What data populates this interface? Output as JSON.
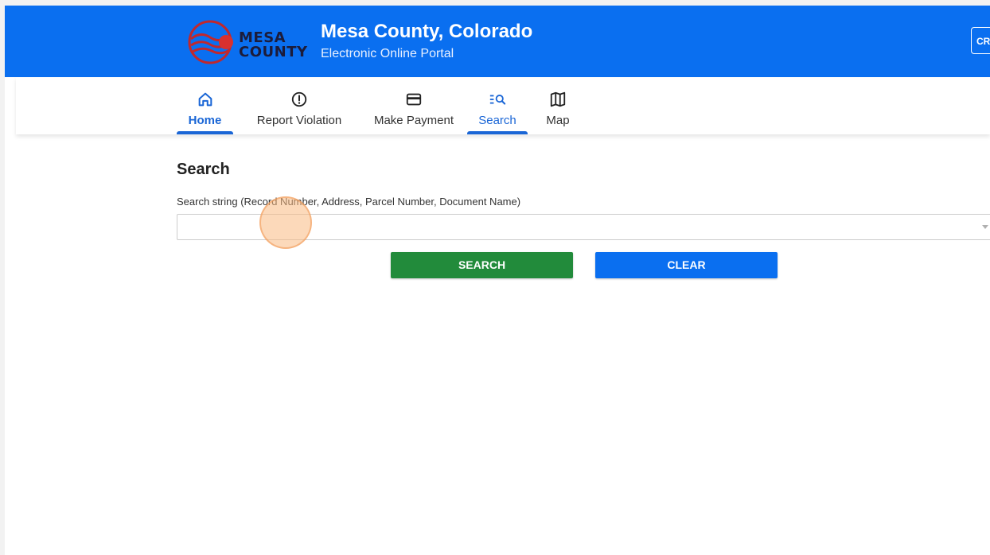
{
  "header": {
    "logo": {
      "line1": "MESA",
      "line2": "COUNTY"
    },
    "title": "Mesa County, Colorado",
    "subtitle": "Electronic Online Portal",
    "right_button_label": "CR",
    "background_color": "#0a6ff0"
  },
  "nav": {
    "items": [
      {
        "label": "Home",
        "icon": "home-icon",
        "active": true
      },
      {
        "label": "Report Violation",
        "icon": "alert-circle-icon",
        "active": false
      },
      {
        "label": "Make Payment",
        "icon": "credit-card-icon",
        "active": false
      },
      {
        "label": "Search",
        "icon": "list-search-icon",
        "active": true
      },
      {
        "label": "Map",
        "icon": "map-icon",
        "active": false
      }
    ],
    "active_color": "#1a66d6"
  },
  "search": {
    "heading": "Search",
    "field_label": "Search string (Record Number, Address, Parcel Number, Document Name)",
    "input_value": "",
    "search_button_label": "SEARCH",
    "clear_button_label": "CLEAR",
    "search_button_color": "#228b3b",
    "clear_button_color": "#0a6ff0"
  }
}
